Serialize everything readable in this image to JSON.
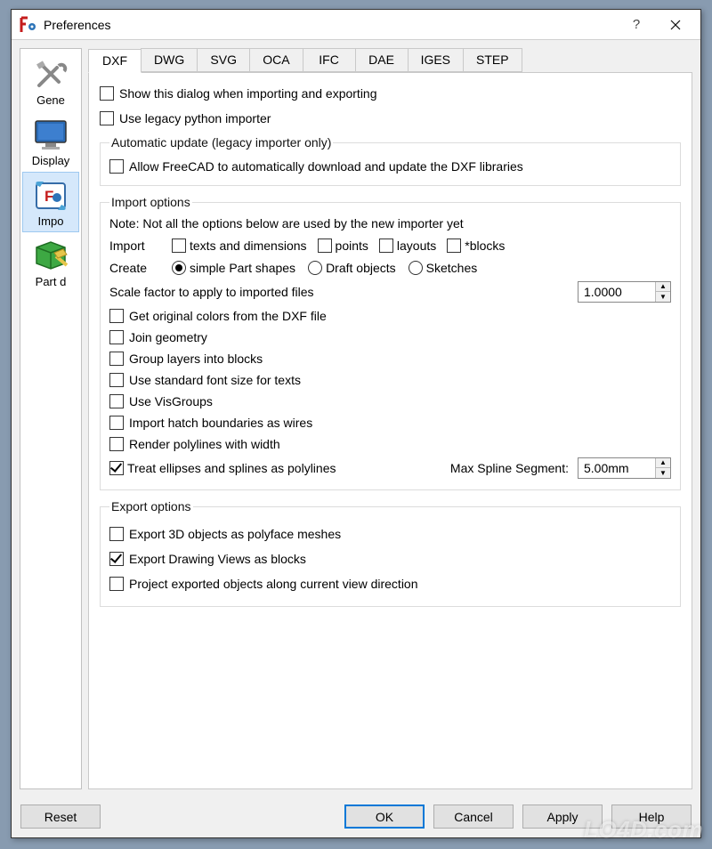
{
  "window": {
    "title": "Preferences"
  },
  "sidebar": {
    "items": [
      {
        "label": "Gene"
      },
      {
        "label": "Display"
      },
      {
        "label": "Impo"
      },
      {
        "label": "Part d"
      }
    ]
  },
  "tabs": [
    "DXF",
    "DWG",
    "SVG",
    "OCA",
    "IFC",
    "DAE",
    "IGES",
    "STEP"
  ],
  "top_checks": {
    "show_dialog": "Show this dialog when importing and exporting",
    "legacy_importer": "Use legacy python importer"
  },
  "auto_update": {
    "legend": "Automatic update (legacy importer only)",
    "allow": "Allow FreeCAD to automatically download and update the DXF libraries"
  },
  "import_options": {
    "legend": "Import options",
    "note": "Note: Not all the options below are used by the new importer yet",
    "import_label": "Import",
    "create_label": "Create",
    "import_items": {
      "texts": "texts and dimensions",
      "points": "points",
      "layouts": "layouts",
      "blocks": "*blocks"
    },
    "create_items": {
      "part_shapes": "simple Part shapes",
      "draft_objects": "Draft objects",
      "sketches": "Sketches"
    },
    "scale_label": "Scale factor to apply to imported files",
    "scale_value": "1.0000",
    "checks": {
      "original_colors": "Get original colors from the DXF file",
      "join_geometry": "Join geometry",
      "group_layers": "Group layers into blocks",
      "std_font": "Use standard font size for texts",
      "visgroups": "Use VisGroups",
      "hatch": "Import hatch boundaries as wires",
      "polylines": "Render polylines with width",
      "ellipses": "Treat ellipses and splines as polylines"
    },
    "max_spline_label": "Max Spline Segment:",
    "max_spline_value": "5.00mm"
  },
  "export_options": {
    "legend": "Export options",
    "polyface": "Export 3D objects as polyface meshes",
    "drawing_views": "Export Drawing Views as blocks",
    "project_exported": "Project exported objects along current view direction"
  },
  "buttons": {
    "reset": "Reset",
    "ok": "OK",
    "cancel": "Cancel",
    "apply": "Apply",
    "help": "Help"
  },
  "watermark": "LO4D.com"
}
